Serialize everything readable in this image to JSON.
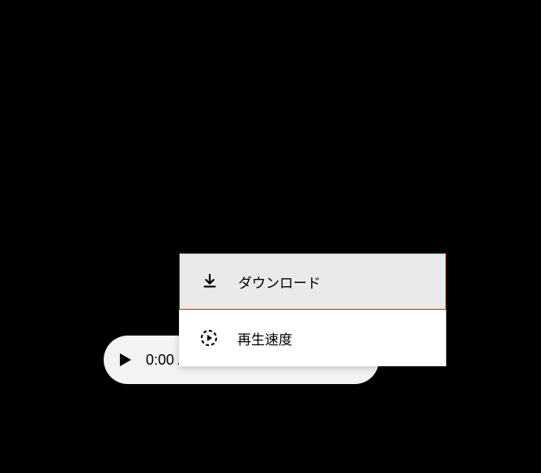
{
  "player": {
    "time": "0:00 /"
  },
  "menu": {
    "download": "ダウンロード",
    "playback_speed": "再生速度"
  }
}
